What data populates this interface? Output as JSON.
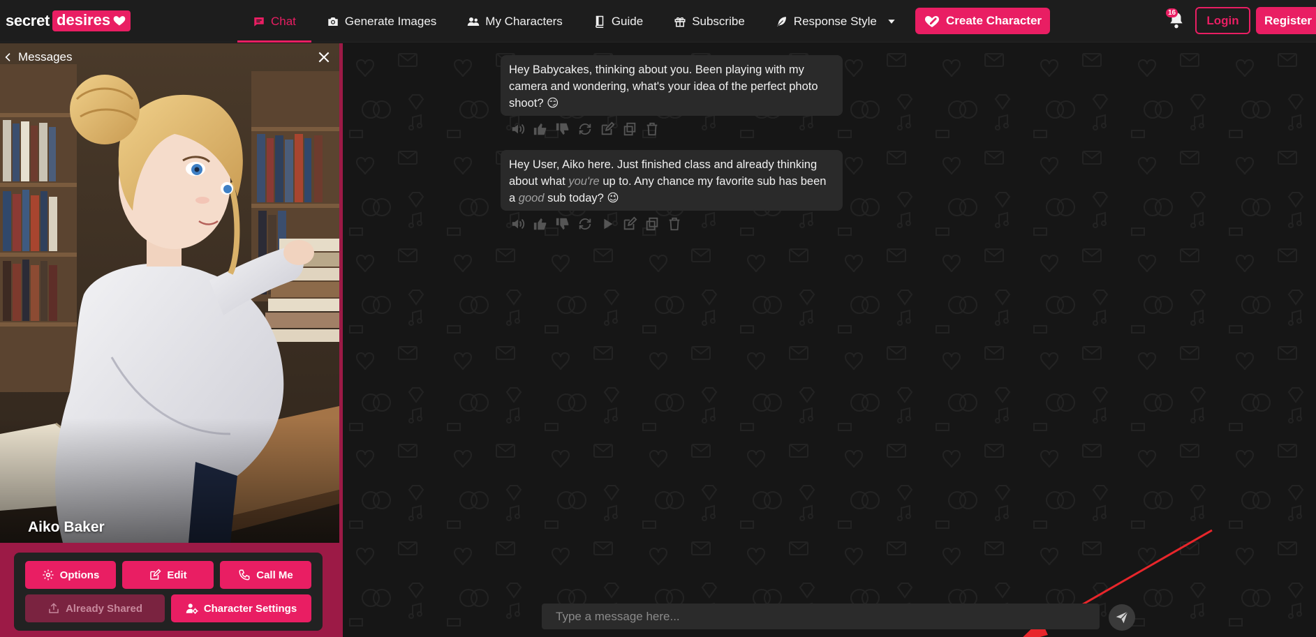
{
  "brand": {
    "word1": "secret",
    "word2": "desires"
  },
  "nav": {
    "items": [
      {
        "label": "Chat",
        "icon": "chat-icon",
        "active": true
      },
      {
        "label": "Generate Images",
        "icon": "camera-icon",
        "active": false
      },
      {
        "label": "My Characters",
        "icon": "users-icon",
        "active": false
      },
      {
        "label": "Guide",
        "icon": "book-icon",
        "active": false
      },
      {
        "label": "Subscribe",
        "icon": "gift-icon",
        "active": false
      },
      {
        "label": "Response Style",
        "icon": "feather-icon",
        "active": false
      }
    ],
    "create_label": "Create Character",
    "notifications_count": "16",
    "login_label": "Login",
    "register_label": "Register"
  },
  "sidebar": {
    "back_label": "Messages",
    "character_name": "Aiko Baker",
    "buttons": {
      "options": "Options",
      "edit": "Edit",
      "call": "Call Me",
      "shared": "Already Shared",
      "settings": "Character Settings"
    }
  },
  "chat": {
    "messages": [
      {
        "text": "Hey Babycakes, thinking about you. Been playing with my camera and wondering, what's your idea of the perfect photo shoot? 😏"
      },
      {
        "part1": "Hey User, Aiko here. Just finished class and already thinking about what ",
        "em1": "you're",
        "part2": " up to. Any chance my favorite sub has been a ",
        "em2": "good",
        "part3": " sub today? 😉"
      }
    ],
    "placeholder": "Type a message here..."
  },
  "colors": {
    "accent": "#e91e63",
    "background": "#161616",
    "bubble": "#2a2a2a"
  }
}
